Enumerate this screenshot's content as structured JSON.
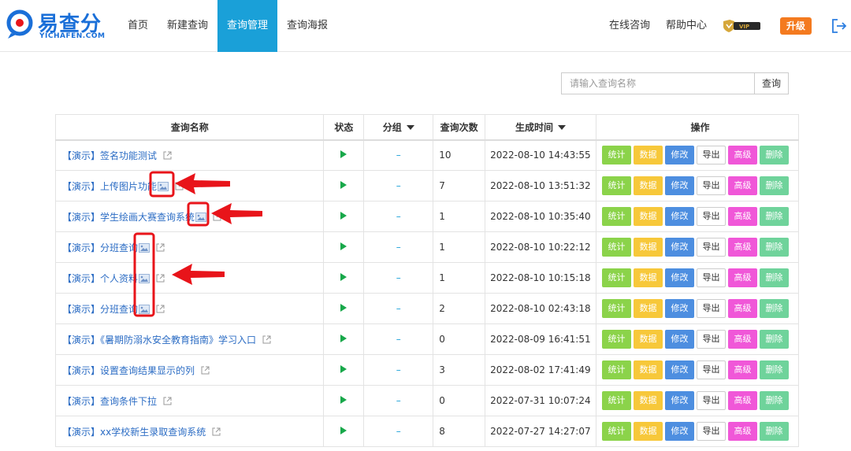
{
  "header": {
    "logo_text": "易查分",
    "logo_sub": "YICHAFEN.COM",
    "nav": [
      "首页",
      "新建查询",
      "查询管理",
      "查询海报"
    ],
    "active_nav": 2,
    "online_consult": "在线咨询",
    "help_center": "帮助中心",
    "vip_label": "VIP",
    "upgrade_label": "升级"
  },
  "search": {
    "placeholder": "请输入查询名称",
    "button_label": "查询"
  },
  "table": {
    "headers": {
      "name": "查询名称",
      "status": "状态",
      "group": "分组",
      "count": "查询次数",
      "time": "生成时间",
      "ops": "操作"
    },
    "op_labels": [
      "统计",
      "数据",
      "修改",
      "导出",
      "高级",
      "删除"
    ],
    "rows": [
      {
        "name": "【演示】签名功能测试",
        "group": "–",
        "count": "10",
        "time": "2022-08-10 14:43:55"
      },
      {
        "name": "【演示】上传图片功能",
        "group": "–",
        "count": "7",
        "time": "2022-08-10 13:51:32"
      },
      {
        "name": "【演示】学生绘画大赛查询系统",
        "group": "–",
        "count": "1",
        "time": "2022-08-10 10:35:40"
      },
      {
        "name": "【演示】分班查询",
        "group": "–",
        "count": "1",
        "time": "2022-08-10 10:22:12"
      },
      {
        "name": "【演示】个人资料",
        "group": "–",
        "count": "1",
        "time": "2022-08-10 10:15:18"
      },
      {
        "name": "【演示】分班查询",
        "group": "–",
        "count": "2",
        "time": "2022-08-10 02:43:18"
      },
      {
        "name": "【演示】《暑期防溺水安全教育指南》学习入口",
        "group": "–",
        "count": "0",
        "time": "2022-08-09 16:41:51"
      },
      {
        "name": "【演示】设置查询结果显示的列",
        "group": "–",
        "count": "3",
        "time": "2022-08-02 17:41:49"
      },
      {
        "name": "【演示】查询条件下拉",
        "group": "–",
        "count": "0",
        "time": "2022-07-31 10:07:24"
      },
      {
        "name": "【演示】xx学校新生录取查询系统",
        "group": "–",
        "count": "8",
        "time": "2022-07-27 14:27:07"
      }
    ]
  },
  "colors": {
    "nav_active": "#1aa0d8",
    "upgrade": "#f47a1f",
    "link": "#2b6cc4",
    "play": "#18a84a",
    "annotation": "#e8141a"
  }
}
